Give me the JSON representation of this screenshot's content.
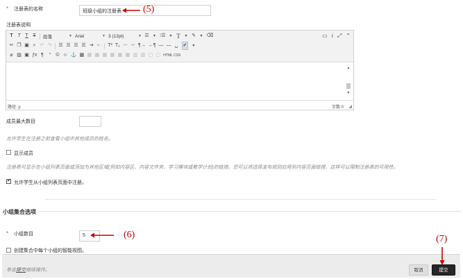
{
  "form": {
    "name_field": {
      "required_marker": "*",
      "label": "注册表的名称",
      "value": "班级小组的注册表"
    },
    "description_label": "注册表说明",
    "editor": {
      "toolbar_row1": [
        "T",
        "T",
        "T",
        "T"
      ],
      "paragraph_select": "段落",
      "font_select": "Arial",
      "size_select": "3 (12pt)",
      "html_css_label": "HTML CSS",
      "path_label": "路径: p",
      "word_count": "字数:0"
    },
    "max_members": {
      "label": "成员最大数目",
      "value": "",
      "hint": "允许学生在注册之前查看小组中其他成员的姓名。"
    },
    "show_members": {
      "label": "显示成员",
      "checked": false
    },
    "register_hint": "注册表可显示在小组列表页面或添加为其他区域(例如内容区、内容文件夹、学习模块或教学计划)的链接。您可以将选择发布规则应用到内容页面链接，这样可以限制注册表的可用性。",
    "allow_from_list": {
      "label": "允许学生从小组列表页面中注册。",
      "checked": true
    }
  },
  "group_set": {
    "section_title": "小组集合选项",
    "group_count": {
      "required_marker": "*",
      "label": "小组数目",
      "value": "5"
    },
    "smart_view": {
      "label": "创建集合中每个小组的智能视图。",
      "checked": false
    }
  },
  "footer": {
    "hint_prefix": "单击",
    "hint_link": "提交",
    "hint_suffix": "继续操作。",
    "cancel_label": "取消",
    "submit_label": "提交"
  },
  "annotations": {
    "a5": "(5)",
    "a6": "(6)",
    "a7": "(7)",
    "color": "#cc0000"
  }
}
